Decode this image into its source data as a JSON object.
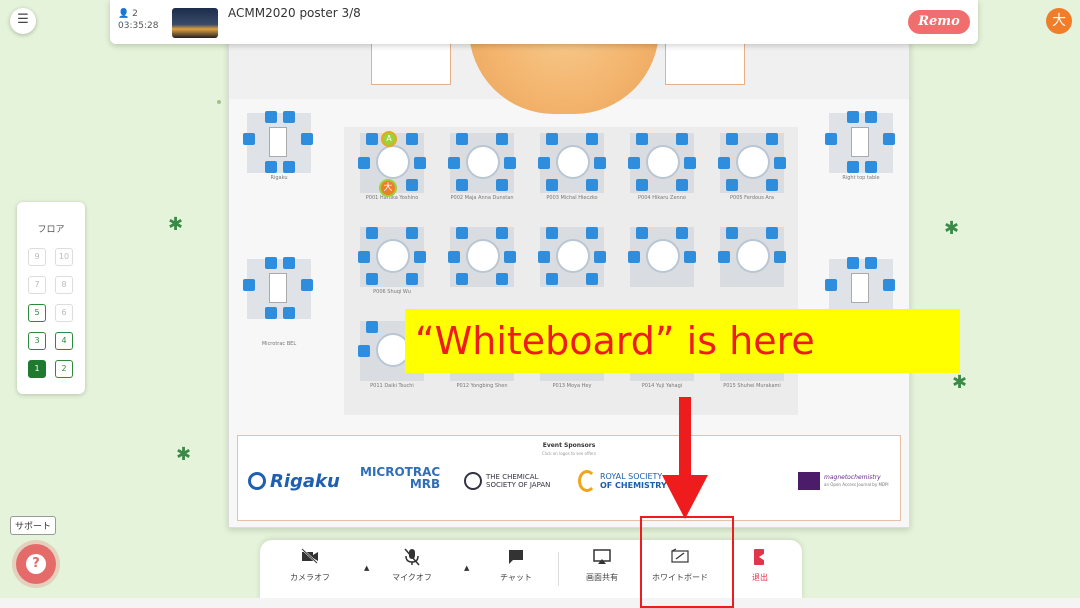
{
  "header": {
    "participants": "2",
    "timer": "03:35:28",
    "room_title": "ACMM2020 poster 3/8",
    "brand": "Remo"
  },
  "user": {
    "avatar_initial": "大"
  },
  "floor_selector": {
    "title": "フロア",
    "floors": [
      "9",
      "10",
      "7",
      "8",
      "5",
      "6",
      "3",
      "4",
      "1",
      "2"
    ],
    "active_floor": "1"
  },
  "tables": [
    {
      "label": "Rigaku"
    },
    {
      "label": "P001 Haruka Yoshino"
    },
    {
      "label": "P002 Maja Anna Dunstan"
    },
    {
      "label": "P003 Michal Hieczko"
    },
    {
      "label": "P004 Hikaru Zenno"
    },
    {
      "label": "P005 Ferdous Ara"
    },
    {
      "label": "Right top table"
    },
    {
      "label": "P006 Shuqi Wu"
    },
    {
      "label": "Microtrac BEL"
    },
    {
      "label": "P011 Daiki Tsuchi"
    },
    {
      "label": "P012 Yongbing Shen"
    },
    {
      "label": "P013 Moya Hey"
    },
    {
      "label": "P014 Yuji Yahagi"
    },
    {
      "label": "P015 Shuhei Murakami"
    }
  ],
  "sponsors": {
    "title": "Event Sponsors",
    "subtitle": "Click on logos to see offers",
    "logos": [
      "Rigaku",
      "MICROTRAC",
      "MRB",
      "THE CHEMICAL",
      "SOCIETY OF JAPAN",
      "ROYAL SOCIETY",
      "OF CHEMISTRY",
      "magnetochemistry",
      "an Open Access Journal by MDPI"
    ]
  },
  "controls": {
    "camera": "カメラオフ",
    "mic": "マイクオフ",
    "chat": "チャット",
    "screen_share": "画面共有",
    "whiteboard": "ホワイトボード",
    "exit": "退出"
  },
  "support": {
    "label": "サポート"
  },
  "annotation": {
    "callout_text": "“Whiteboard” is here"
  }
}
